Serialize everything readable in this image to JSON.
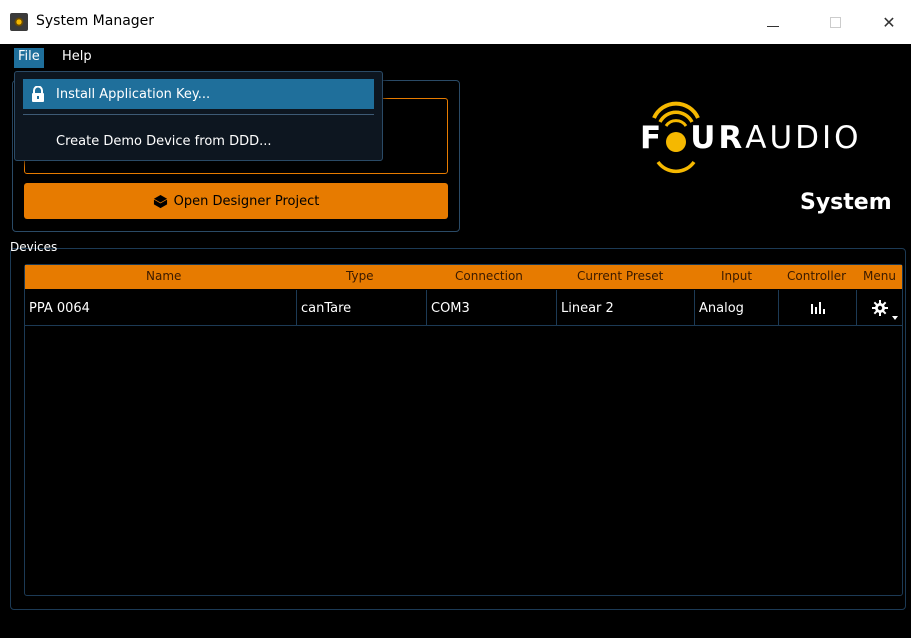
{
  "window": {
    "title": "System Manager",
    "minimize": "—",
    "close": "✕"
  },
  "menubar": {
    "file": "File",
    "help": "Help"
  },
  "file_menu": {
    "items": [
      {
        "label": "Install Application Key...",
        "icon": "lock-icon"
      },
      {
        "label": "Create Demo Device from DDD..."
      }
    ]
  },
  "actions": {
    "open_designer": "Open Designer Project"
  },
  "logo": {
    "four_left": "F",
    "four_right": "UR",
    "audio": "AUDIO",
    "product": "System"
  },
  "devices": {
    "label": "Devices",
    "columns": [
      "Name",
      "Type",
      "Connection",
      "Current Preset",
      "Input",
      "Controller",
      "Menu"
    ],
    "rows": [
      {
        "name": "PPA 0064",
        "type": "canTare",
        "connection": "COM3",
        "preset": "Linear 2",
        "input": "Analog"
      }
    ]
  },
  "colors": {
    "accent": "#e77b00",
    "highlight": "#1f6f9b",
    "logo_yellow": "#f5b800"
  }
}
